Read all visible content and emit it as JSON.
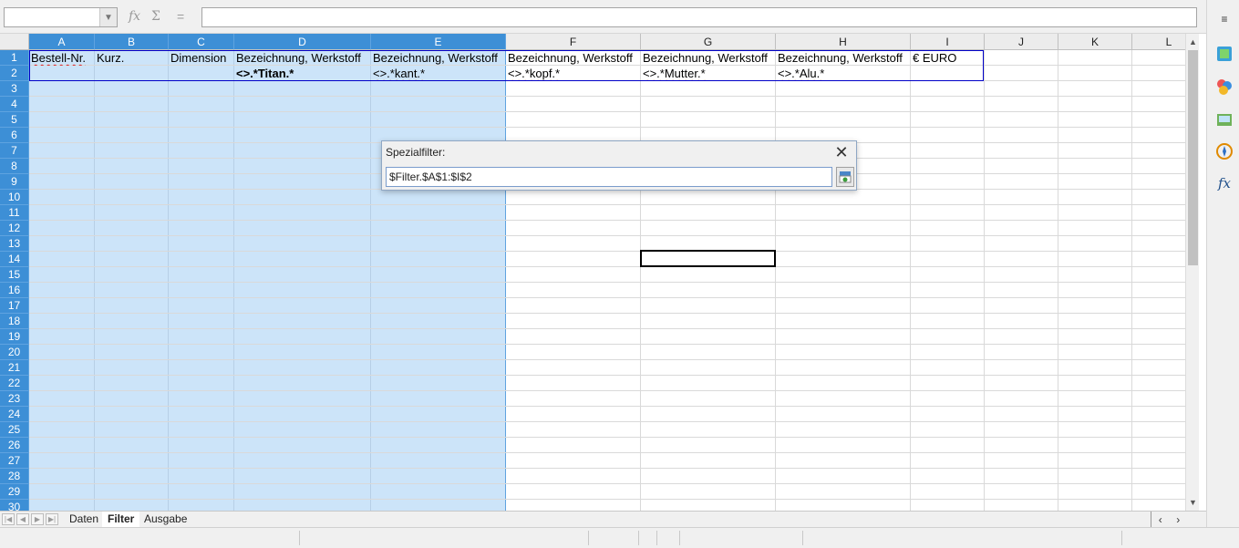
{
  "formula_bar": {
    "name_box": "",
    "formula": "",
    "function_wizard_icon": "function-wizard-icon",
    "sum_icon": "sum-icon",
    "equals_label": "="
  },
  "grid": {
    "columns": [
      "A",
      "B",
      "C",
      "D",
      "E",
      "F",
      "G",
      "H",
      "I",
      "J",
      "K",
      "L"
    ],
    "selected_columns": [
      "A",
      "B",
      "C",
      "D",
      "E"
    ],
    "rows": [
      "1",
      "2",
      "3",
      "4",
      "5",
      "6",
      "7",
      "8",
      "9",
      "10",
      "11",
      "12",
      "13",
      "14",
      "15",
      "16",
      "17",
      "18",
      "19",
      "20",
      "21",
      "22",
      "23",
      "24",
      "25",
      "26",
      "27",
      "28",
      "29",
      "30"
    ],
    "row1": {
      "A": "Bestell-Nr.",
      "B": "Kurz.",
      "C": "Dimension",
      "D": "Bezeichnung, Werkstoff",
      "E": "Bezeichnung, Werkstoff",
      "F": "Bezeichnung, Werkstoff",
      "G": "Bezeichnung, Werkstoff",
      "H": "Bezeichnung, Werkstoff",
      "I": "€ EURO"
    },
    "row2": {
      "D": "<>.*Titan.*",
      "E": "<>.*kant.*",
      "F": "<>.*kopf.*",
      "G": "<>.*Mutter.*",
      "H": "<>.*Alu.*"
    },
    "active_cell": "G14"
  },
  "dialog": {
    "title": "Spezialfilter:",
    "range_value": "$Filter.$A$1:$I$2",
    "close_icon": "close-icon",
    "shrink_icon": "shrink-dialog-icon"
  },
  "sheet_tabs": [
    {
      "label": "Daten",
      "active": false
    },
    {
      "label": "Filter",
      "active": true
    },
    {
      "label": "Ausgabe",
      "active": false
    }
  ],
  "sidebar_icons": [
    "properties-icon",
    "styles-icon",
    "gallery-icon",
    "navigator-icon",
    "functions-icon"
  ],
  "colors": {
    "selection": "#cce4f9",
    "header_selected": "#3d8fd6",
    "criteria_border": "#0000c8"
  }
}
